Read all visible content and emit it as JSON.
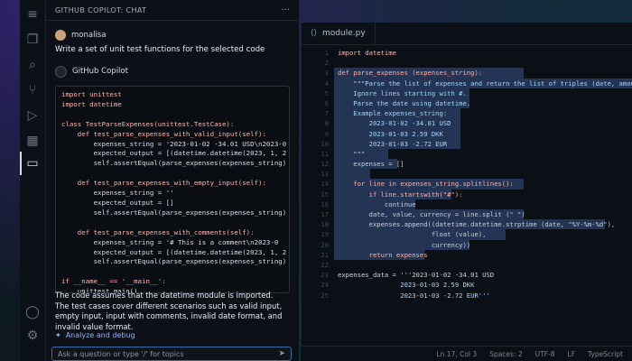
{
  "chat": {
    "title": "GITHUB COPILOT: CHAT",
    "user_name": "monalisa",
    "user_message": "Write a set of unit test functions for the selected code",
    "assistant_name": "GitHub Copilot",
    "code": [
      "import unittest",
      "import datetime",
      "",
      "class TestParseExpenses(unittest.TestCase):",
      "    def test_parse_expenses_with_valid_input(self):",
      "        expenses_string = '2023-01-02 -34.01 USD\\n2023-0",
      "        expected_output = [(datetime.datetime(2023, 1, 2",
      "        self.assertEqual(parse_expenses(expenses_string)",
      "",
      "    def test_parse_expenses_with_empty_input(self):",
      "        expenses_string = ''",
      "        expected_output = []",
      "        self.assertEqual(parse_expenses(expenses_string)",
      "",
      "    def test_parse_expenses_with_comments(self):",
      "        expenses_string = '# This is a comment\\n2023-0",
      "        expected_output = [(datetime.datetime(2023, 1, 2",
      "        self.assertEqual(parse_expenses(expenses_string)",
      "",
      "if __name__ == '__main__':",
      "    unittest.main()"
    ],
    "assistant_text": "The code assumes that the datetime module is imported. The test cases cover different scenarios such as valid input, empty input, input with comments, invalid date format, and invalid value format.",
    "analyze_label": "Analyze and debug",
    "input_placeholder": "Ask a question or type '/' for topics"
  },
  "editor": {
    "tab_label": "module.py",
    "lines": [
      "import datetime",
      "",
      "def parse_expenses (expenses_string):",
      "    \"\"\"Parse the list of expenses and return the list of triples (date, amount, currency",
      "    Ignore lines starting with #.",
      "    Parse the date using datetime.",
      "    Example expenses_string:",
      "        2023-01-02 -34.01 USD",
      "        2023-01-03 2.59 DKK",
      "        2023-01-03 -2.72 EUR",
      "    \"\"\"",
      "    expenses = []",
      "",
      "    for line in expenses_string.splitlines():",
      "        if line.startswith(\"#\"):",
      "            continue",
      "        date, value, currency = line.split (\" \")",
      "        expenses.append((datetime.datetime.strptime (date, \"%Y-%m-%d\"),",
      "                        float (value),",
      "                        currency))",
      "        return expenses",
      "",
      "expenses_data = '''2023-01-02 -34.01 USD",
      "                2023-01-03 2.59 DKK",
      "                2023-01-03 -2.72 EUR'''"
    ],
    "line_numbers": [
      "1",
      "2",
      "3",
      "4",
      "5",
      "6",
      "7",
      "8",
      "9",
      "10",
      "11",
      "12",
      "13",
      "14",
      "15",
      "16",
      "17",
      "18",
      "19",
      "20",
      "21",
      "22",
      "23",
      "24",
      "25"
    ]
  },
  "status": {
    "cursor": "Ln 17, Col 3",
    "spaces": "Spaces: 2",
    "encoding": "UTF-8",
    "eol": "LF",
    "language": "TypeScript"
  }
}
